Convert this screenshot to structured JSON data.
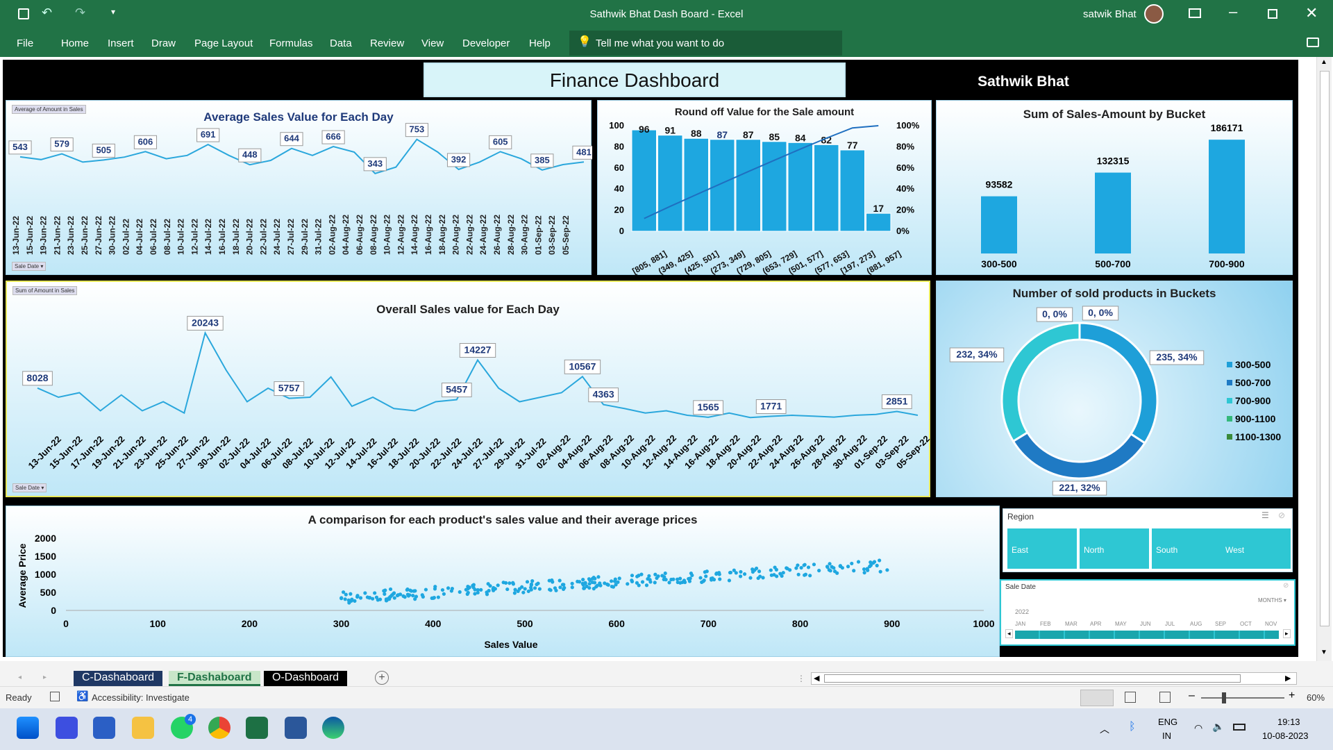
{
  "window": {
    "title": "Sathwik Bhat Dash Board  -  Excel",
    "user": "satwik Bhat"
  },
  "ribbon_tabs": [
    "File",
    "Home",
    "Insert",
    "Draw",
    "Page Layout",
    "Formulas",
    "Data",
    "Review",
    "View",
    "Developer",
    "Help"
  ],
  "tell_me": "Tell me what you want to do",
  "dashboard": {
    "title": "Finance Dashboard",
    "author": "Sathwik  Bhat"
  },
  "avg_chart": {
    "tag": "Average of Amount in Sales",
    "title": "Average Sales Value for Each Day",
    "filter": "Sale Date",
    "labels": [
      {
        "v": "543"
      },
      {
        "v": "579"
      },
      {
        "v": "505"
      },
      {
        "v": "606"
      },
      {
        "v": "691"
      },
      {
        "v": "448"
      },
      {
        "v": "644"
      },
      {
        "v": "666"
      },
      {
        "v": "343"
      },
      {
        "v": "753"
      },
      {
        "v": "392"
      },
      {
        "v": "605"
      },
      {
        "v": "385"
      },
      {
        "v": "481"
      }
    ],
    "dates": [
      "13-Jun-22",
      "15-Jun-22",
      "19-Jun-22",
      "21-Jun-22",
      "23-Jun-22",
      "25-Jun-22",
      "27-Jun-22",
      "30-Jun-22",
      "02-Jul-22",
      "04-Jul-22",
      "06-Jul-22",
      "08-Jul-22",
      "10-Jul-22",
      "12-Jul-22",
      "14-Jul-22",
      "16-Jul-22",
      "18-Jul-22",
      "20-Jul-22",
      "22-Jul-22",
      "24-Jul-22",
      "27-Jul-22",
      "29-Jul-22",
      "31-Jul-22",
      "02-Aug-22",
      "04-Aug-22",
      "06-Aug-22",
      "08-Aug-22",
      "10-Aug-22",
      "12-Aug-22",
      "14-Aug-22",
      "16-Aug-22",
      "18-Aug-22",
      "20-Aug-22",
      "22-Aug-22",
      "24-Aug-22",
      "26-Aug-22",
      "28-Aug-22",
      "30-Aug-22",
      "01-Sep-22",
      "03-Sep-22",
      "05-Sep-22"
    ]
  },
  "round_chart": {
    "title": "Round off Value for the Sale amount",
    "categories": [
      "[805, 881]",
      "(349, 425]",
      "(425, 501]",
      "(273, 349]",
      "(729, 805]",
      "(653, 729]",
      "(501, 577]",
      "(577, 653]",
      "[197, 273]",
      "(881, 957]"
    ],
    "values": [
      96,
      91,
      88,
      87,
      87,
      85,
      84,
      82,
      77,
      17
    ],
    "y_ticks": [
      "0",
      "20",
      "40",
      "60",
      "80",
      "100"
    ],
    "y2_ticks": [
      "0%",
      "20%",
      "40%",
      "60%",
      "80%",
      "100%"
    ]
  },
  "bucket_chart": {
    "title": "Sum of Sales-Amount by Bucket",
    "categories": [
      "300-500",
      "500-700",
      "700-900"
    ],
    "values": [
      93582,
      132315,
      186171
    ]
  },
  "overall_chart": {
    "tag": "Sum of Amount in Sales",
    "title": "Overall Sales value for Each Day",
    "filter": "Sale Date",
    "labels": [
      {
        "v": "8028"
      },
      {
        "v": "20243"
      },
      {
        "v": "5757"
      },
      {
        "v": "14227"
      },
      {
        "v": "5457"
      },
      {
        "v": "10567"
      },
      {
        "v": "4363"
      },
      {
        "v": "1565"
      },
      {
        "v": "1771"
      },
      {
        "v": "2851"
      }
    ],
    "dates": [
      "13-Jun-22",
      "15-Jun-22",
      "17-Jun-22",
      "19-Jun-22",
      "21-Jun-22",
      "23-Jun-22",
      "25-Jun-22",
      "27-Jun-22",
      "30-Jun-22",
      "02-Jul-22",
      "04-Jul-22",
      "06-Jul-22",
      "08-Jul-22",
      "10-Jul-22",
      "12-Jul-22",
      "14-Jul-22",
      "16-Jul-22",
      "18-Jul-22",
      "20-Jul-22",
      "22-Jul-22",
      "24-Jul-22",
      "27-Jul-22",
      "29-Jul-22",
      "31-Jul-22",
      "02-Aug-22",
      "04-Aug-22",
      "06-Aug-22",
      "08-Aug-22",
      "10-Aug-22",
      "12-Aug-22",
      "14-Aug-22",
      "16-Aug-22",
      "18-Aug-22",
      "20-Aug-22",
      "22-Aug-22",
      "24-Aug-22",
      "26-Aug-22",
      "28-Aug-22",
      "30-Aug-22",
      "01-Sep-22",
      "03-Sep-22",
      "05-Sep-22"
    ]
  },
  "donut_chart": {
    "title": "Number of sold products in Buckets",
    "slices": [
      {
        "name": "300-500",
        "label": "235, 34%",
        "value": 235,
        "color": "#1e9fd8"
      },
      {
        "name": "500-700",
        "label": "221, 32%",
        "value": 221,
        "color": "#1f7ac4"
      },
      {
        "name": "700-900",
        "label": "232, 34%",
        "value": 232,
        "color": "#2ec7d3"
      },
      {
        "name": "900-1100",
        "label": "0, 0%",
        "value": 0,
        "color": "#34b87a"
      },
      {
        "name": "1100-1300",
        "label": "0, 0%",
        "value": 0,
        "color": "#3a8a3a"
      }
    ]
  },
  "scatter_chart": {
    "title": "A comparison for each product's sales value and their average prices",
    "xlabel": "Sales Value",
    "ylabel": "Average Price",
    "x_ticks": [
      "0",
      "100",
      "200",
      "300",
      "400",
      "500",
      "600",
      "700",
      "800",
      "900",
      "1000"
    ],
    "y_ticks": [
      "0",
      "500",
      "1000",
      "1500",
      "2000"
    ]
  },
  "region_slicer": {
    "title": "Region",
    "items": [
      "East",
      "North",
      "South",
      "West"
    ]
  },
  "date_slicer": {
    "title": "Sale Date",
    "level": "MONTHS",
    "year": "2022",
    "months": [
      "JAN",
      "FEB",
      "MAR",
      "APR",
      "MAY",
      "JUN",
      "JUL",
      "AUG",
      "SEP",
      "OCT",
      "NOV"
    ]
  },
  "sheets": [
    "C-Dashaboard",
    "F-Dashaboard",
    "O-Dashboard"
  ],
  "status": {
    "ready": "Ready",
    "accessibility": "Accessibility: Investigate",
    "zoom": "60%"
  },
  "taskbar": {
    "lang1": "ENG",
    "lang2": "IN",
    "time": "19:13",
    "date": "10-08-2023",
    "whatsapp_badge": "4"
  },
  "chart_data": [
    {
      "type": "line",
      "title": "Average Sales Value for Each Day",
      "values": [
        543,
        510,
        579,
        480,
        505,
        540,
        606,
        520,
        560,
        691,
        560,
        448,
        500,
        644,
        560,
        666,
        600,
        343,
        420,
        753,
        600,
        392,
        480,
        605,
        520,
        385,
        450,
        481
      ]
    },
    {
      "type": "bar",
      "title": "Round off Value for the Sale amount",
      "categories": [
        "[805, 881]",
        "(349, 425]",
        "(425, 501]",
        "(273, 349]",
        "(729, 805]",
        "(653, 729]",
        "(501, 577]",
        "(577, 653]",
        "[197, 273]",
        "(881, 957]"
      ],
      "values": [
        96,
        91,
        88,
        87,
        87,
        85,
        84,
        82,
        77,
        17
      ]
    },
    {
      "type": "bar",
      "title": "Sum of Sales-Amount by Bucket",
      "categories": [
        "300-500",
        "500-700",
        "700-900"
      ],
      "values": [
        93582,
        132315,
        186171
      ]
    },
    {
      "type": "line",
      "title": "Overall Sales value for Each Day",
      "values": [
        8028,
        6000,
        7000,
        3000,
        6500,
        3000,
        5000,
        2500,
        20243,
        12000,
        5000,
        8000,
        5757,
        6000,
        10500,
        4000,
        6000,
        3500,
        3000,
        5000,
        5457,
        14227,
        8000,
        5000,
        6000,
        7000,
        10567,
        4363,
        3500,
        2500,
        3000,
        2000,
        1565,
        2500,
        1500,
        1771,
        2000,
        1800,
        1600,
        2000,
        2200,
        2851,
        2000
      ]
    },
    {
      "type": "pie",
      "title": "Number of sold products in Buckets",
      "categories": [
        "300-500",
        "500-700",
        "700-900",
        "900-1100",
        "1100-1300"
      ],
      "values": [
        235,
        221,
        232,
        0,
        0
      ]
    },
    {
      "type": "scatter",
      "title": "A comparison for each product's sales value and their average prices",
      "xlabel": "Sales Value",
      "ylabel": "Average Price",
      "xlim": [
        0,
        1000
      ],
      "ylim": [
        0,
        2000
      ]
    }
  ]
}
